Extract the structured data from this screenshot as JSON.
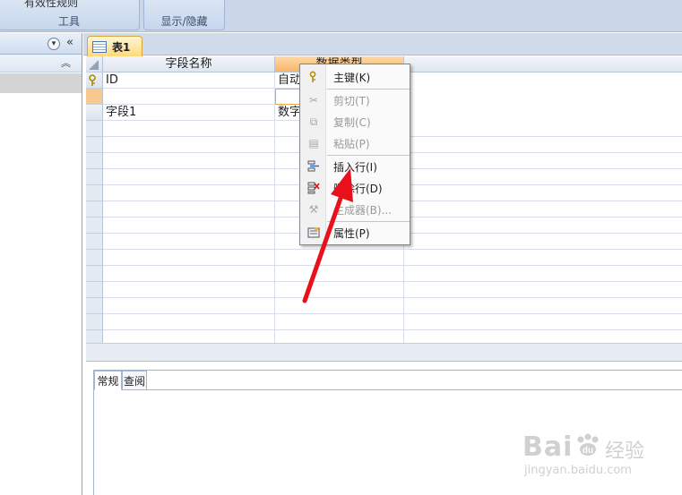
{
  "ribbon": {
    "group_tools_label": "工具",
    "group_tools_top_item": "有效性规则",
    "group_showhide_label": "显示/隐藏"
  },
  "nav": {
    "collapse_icon": "chevron-down-icon",
    "shutter_icon": "double-chevron-left-icon",
    "section_toggle_icon": "double-chevron-up-icon"
  },
  "document": {
    "tab_label": "表1"
  },
  "grid": {
    "columns": [
      "字段名称",
      "数据类型"
    ],
    "rows": [
      {
        "field": "ID",
        "type": "自动",
        "primary_key": true
      },
      {
        "field": "",
        "type": "",
        "primary_key": false
      },
      {
        "field": "字段1",
        "type": "数字",
        "primary_key": false
      }
    ]
  },
  "lower_pane": {
    "tabs": [
      "常规",
      "查阅"
    ]
  },
  "context_menu": {
    "items": [
      {
        "label": "主键(K)",
        "icon": "key-icon",
        "enabled": true
      },
      {
        "label": "剪切(T)",
        "icon": "scissors-icon",
        "enabled": false
      },
      {
        "label": "复制(C)",
        "icon": "copy-icon",
        "enabled": false
      },
      {
        "label": "粘贴(P)",
        "icon": "paste-icon",
        "enabled": false
      },
      {
        "label": "插入行(I)",
        "icon": "insert-row-icon",
        "enabled": true
      },
      {
        "label": "删除行(D)",
        "icon": "delete-row-icon",
        "enabled": true
      },
      {
        "label": "生成器(B)...",
        "icon": "builder-icon",
        "enabled": false
      },
      {
        "label": "属性(P)",
        "icon": "properties-icon",
        "enabled": true
      }
    ]
  },
  "colors": {
    "accent_tab": "#ffd97a",
    "annotation_arrow": "#e8101a"
  },
  "watermark": {
    "brand": "Bai",
    "brand_suffix": "经验",
    "url": "jingyan.baidu.com"
  }
}
